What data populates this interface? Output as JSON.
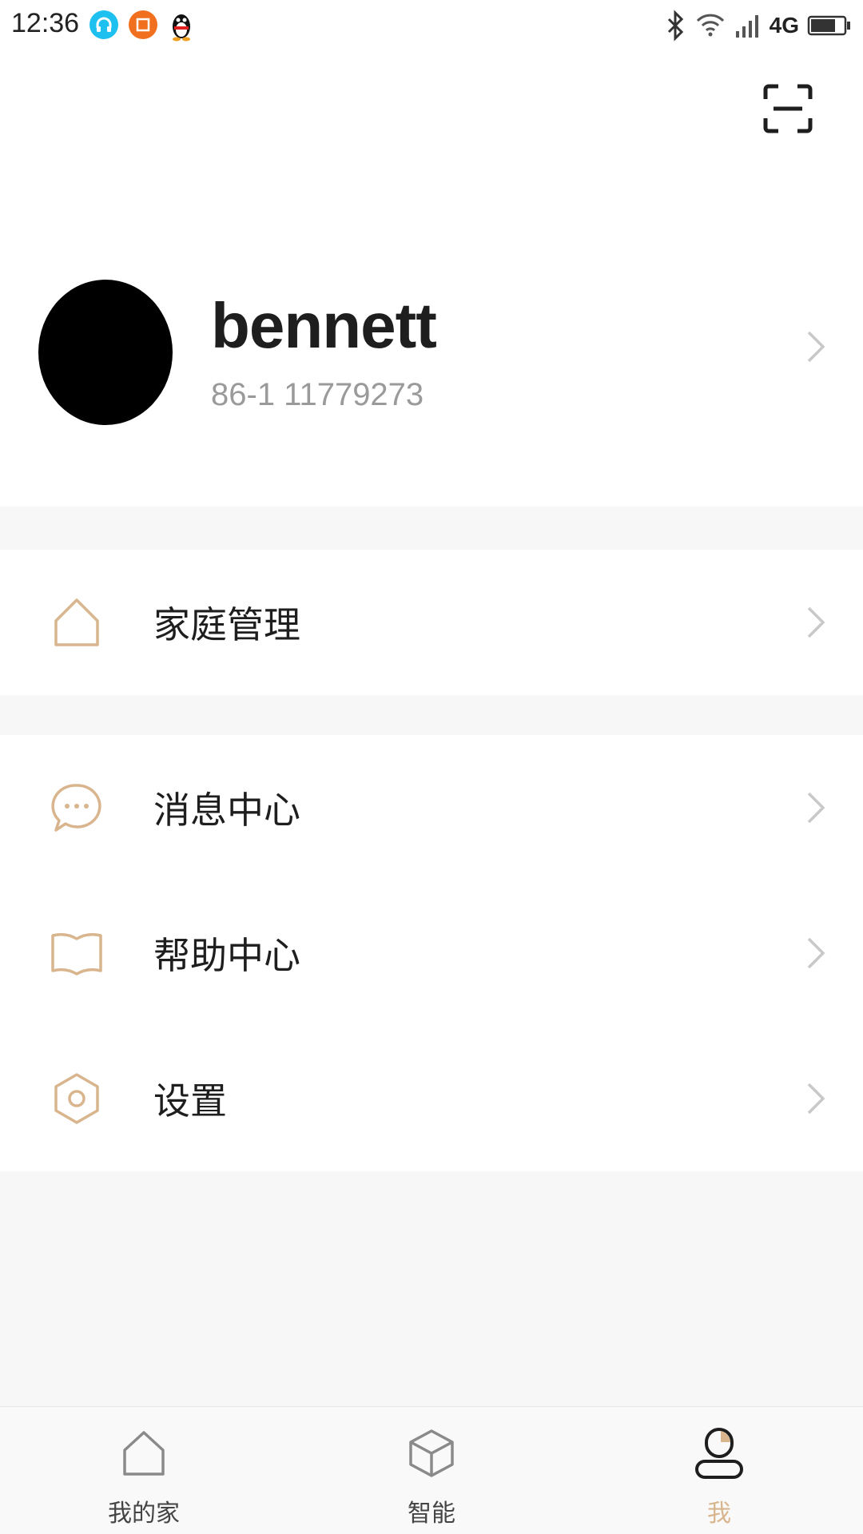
{
  "status_bar": {
    "time": "12:36",
    "network": "4G",
    "battery_level": 0.75
  },
  "profile": {
    "name": "bennett",
    "phone": "86-1   11779273"
  },
  "menu": [
    {
      "label": "家庭管理",
      "icon": "home-icon"
    },
    {
      "label": "消息中心",
      "icon": "message-icon"
    },
    {
      "label": "帮助中心",
      "icon": "book-icon"
    },
    {
      "label": "设置",
      "icon": "settings-icon"
    }
  ],
  "bottom_nav": {
    "tabs": [
      {
        "label": "我的家",
        "icon": "home-icon",
        "active": false
      },
      {
        "label": "智能",
        "icon": "cube-icon",
        "active": false
      },
      {
        "label": "我",
        "icon": "user-icon",
        "active": true
      }
    ]
  },
  "colors": {
    "accent": "#d9b58e",
    "background": "#f7f7f7"
  }
}
